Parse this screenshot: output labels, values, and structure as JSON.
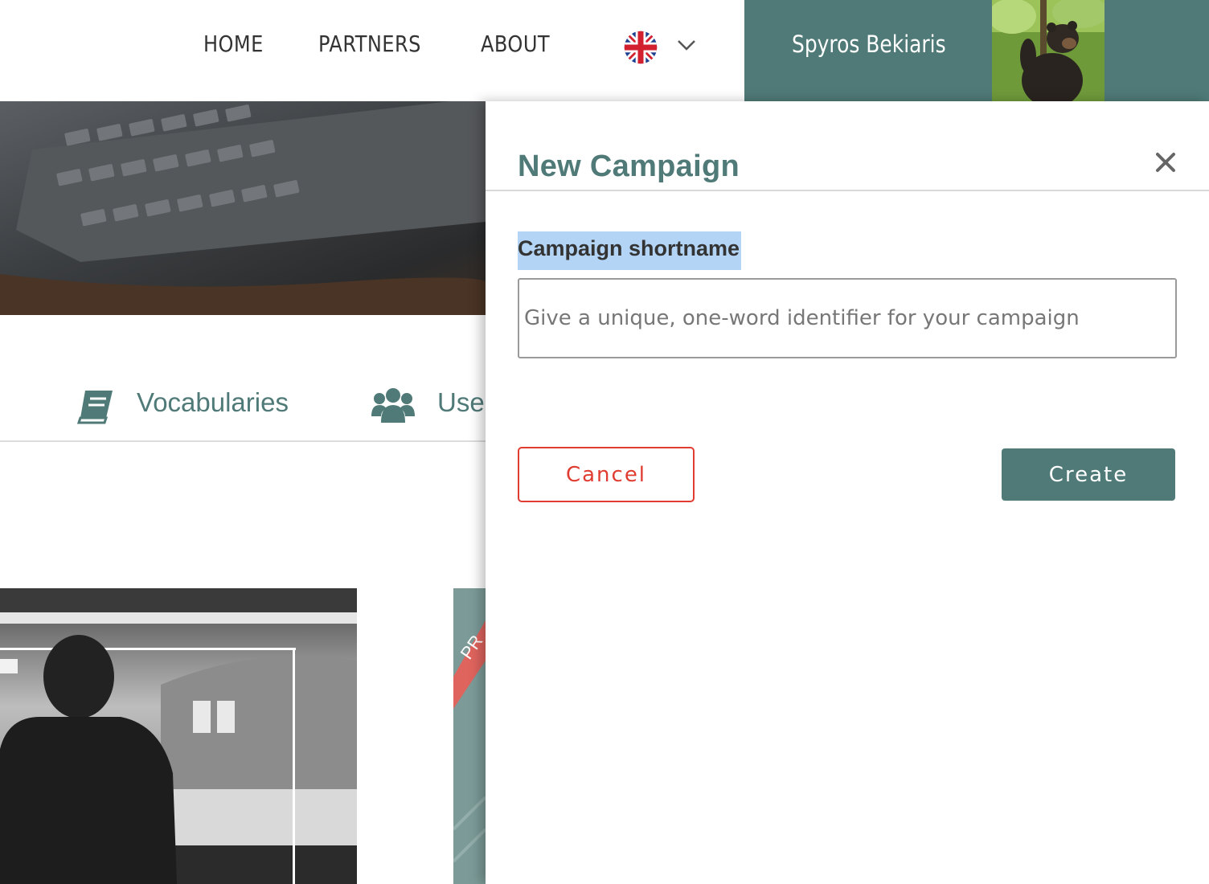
{
  "nav": {
    "home": "HOME",
    "partners": "PARTNERS",
    "about": "ABOUT",
    "language_icon": "uk-flag-icon",
    "language_dropdown_icon": "chevron-down-icon"
  },
  "user": {
    "name": "Spyros Bekiaris",
    "avatar": "bear-photo"
  },
  "tabs": [
    {
      "label": "Vocabularies",
      "icon": "book-icon"
    },
    {
      "label": "User",
      "icon": "users-icon"
    }
  ],
  "background_cards": [
    {
      "type": "photo",
      "description_icon": "photo-grayscale"
    },
    {
      "type": "ribbon",
      "ribbon_text": "PR",
      "ribbon_color": "#e0645e"
    }
  ],
  "panel": {
    "title": "New Campaign",
    "close_icon": "close-icon",
    "field_label": "Campaign shortname",
    "field_placeholder": "Give a unique, one-word identifier for your campaign",
    "field_value": "",
    "cancel_label": "Cancel",
    "create_label": "Create"
  },
  "colors": {
    "accent": "#4f7a77",
    "danger": "#e03c31",
    "selection": "#b3d4f5"
  }
}
